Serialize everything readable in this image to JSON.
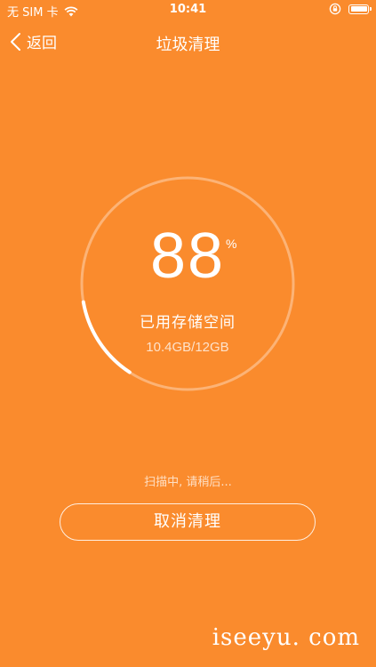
{
  "status_bar": {
    "carrier": "无 SIM 卡",
    "time": "10:41",
    "wifi_icon": "wifi-icon",
    "rotation_lock_icon": "rotation-lock-icon",
    "battery_icon": "battery-icon"
  },
  "nav": {
    "back_label": "返回",
    "back_icon": "chevron-left-icon",
    "title": "垃圾清理"
  },
  "gauge": {
    "percent": "88",
    "percent_unit": "%",
    "progress_fraction": 0.88,
    "label": "已用存储空间",
    "usage": "10.4GB/12GB"
  },
  "scan_status": "扫描中, 请稍后...",
  "cancel_button_label": "取消清理",
  "watermark": "iseeyu. com",
  "colors": {
    "background": "#FA8B2D",
    "text": "#FFFFFF"
  }
}
